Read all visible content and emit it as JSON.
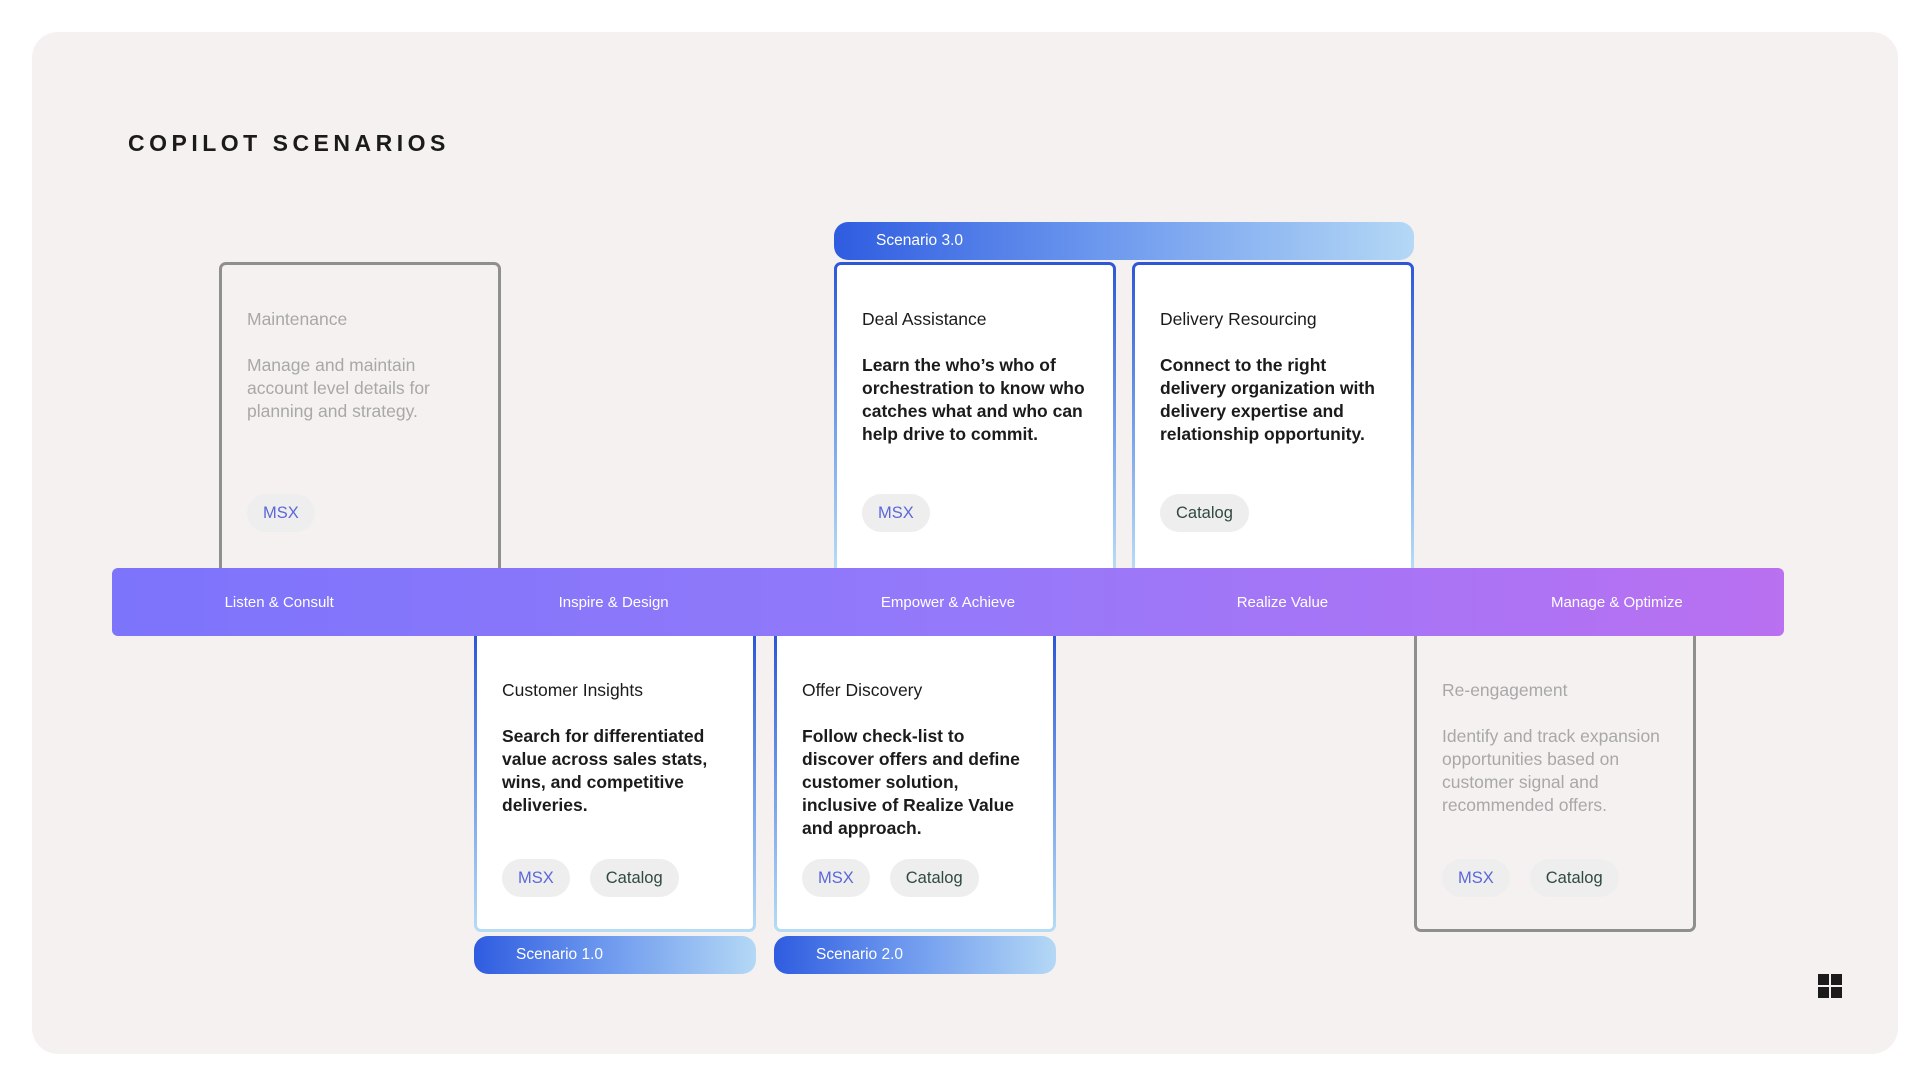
{
  "title": "COPILOT SCENARIOS",
  "stages": [
    "Listen & Consult",
    "Inspire & Design",
    "Empower & Achieve",
    "Realize Value",
    "Manage & Optimize"
  ],
  "scenarios": {
    "s1": "Scenario 1.0",
    "s2": "Scenario 2.0",
    "s3": "Scenario 3.0"
  },
  "cards": {
    "maintenance": {
      "title": "Maintenance",
      "desc": "Manage and maintain account level details for planning and strategy.",
      "tags": [
        "MSX"
      ]
    },
    "deal_assistance": {
      "title": "Deal Assistance",
      "desc": "Learn the who’s who of orchestration to know who catches what and who can help drive to commit.",
      "tags": [
        "MSX"
      ]
    },
    "delivery_resourcing": {
      "title": "Delivery Resourcing",
      "desc": "Connect to the right delivery organization with delivery expertise and relationship opportunity.",
      "tags": [
        "Catalog"
      ]
    },
    "customer_insights": {
      "title": "Customer Insights",
      "desc": "Search for differentiated value across sales stats, wins, and competitive deliveries.",
      "tags": [
        "MSX",
        "Catalog"
      ]
    },
    "offer_discovery": {
      "title": "Offer Discovery",
      "desc": "Follow check-list to discover offers and define customer solution, inclusive of Realize Value and approach.",
      "tags": [
        "MSX",
        "Catalog"
      ]
    },
    "reengagement": {
      "title": "Re-engagement",
      "desc": "Identify and track expansion opportunities based on customer signal and recommended offers.",
      "tags": [
        "MSX",
        "Catalog"
      ]
    }
  },
  "colors": {
    "stage_bar_start": "#7c74fb",
    "stage_bar_end": "#b970f1",
    "scenario_blue": "#2f5ce0",
    "inactive_border": "#8f8f8f"
  },
  "icons": [
    "microsoft-logo-icon"
  ]
}
